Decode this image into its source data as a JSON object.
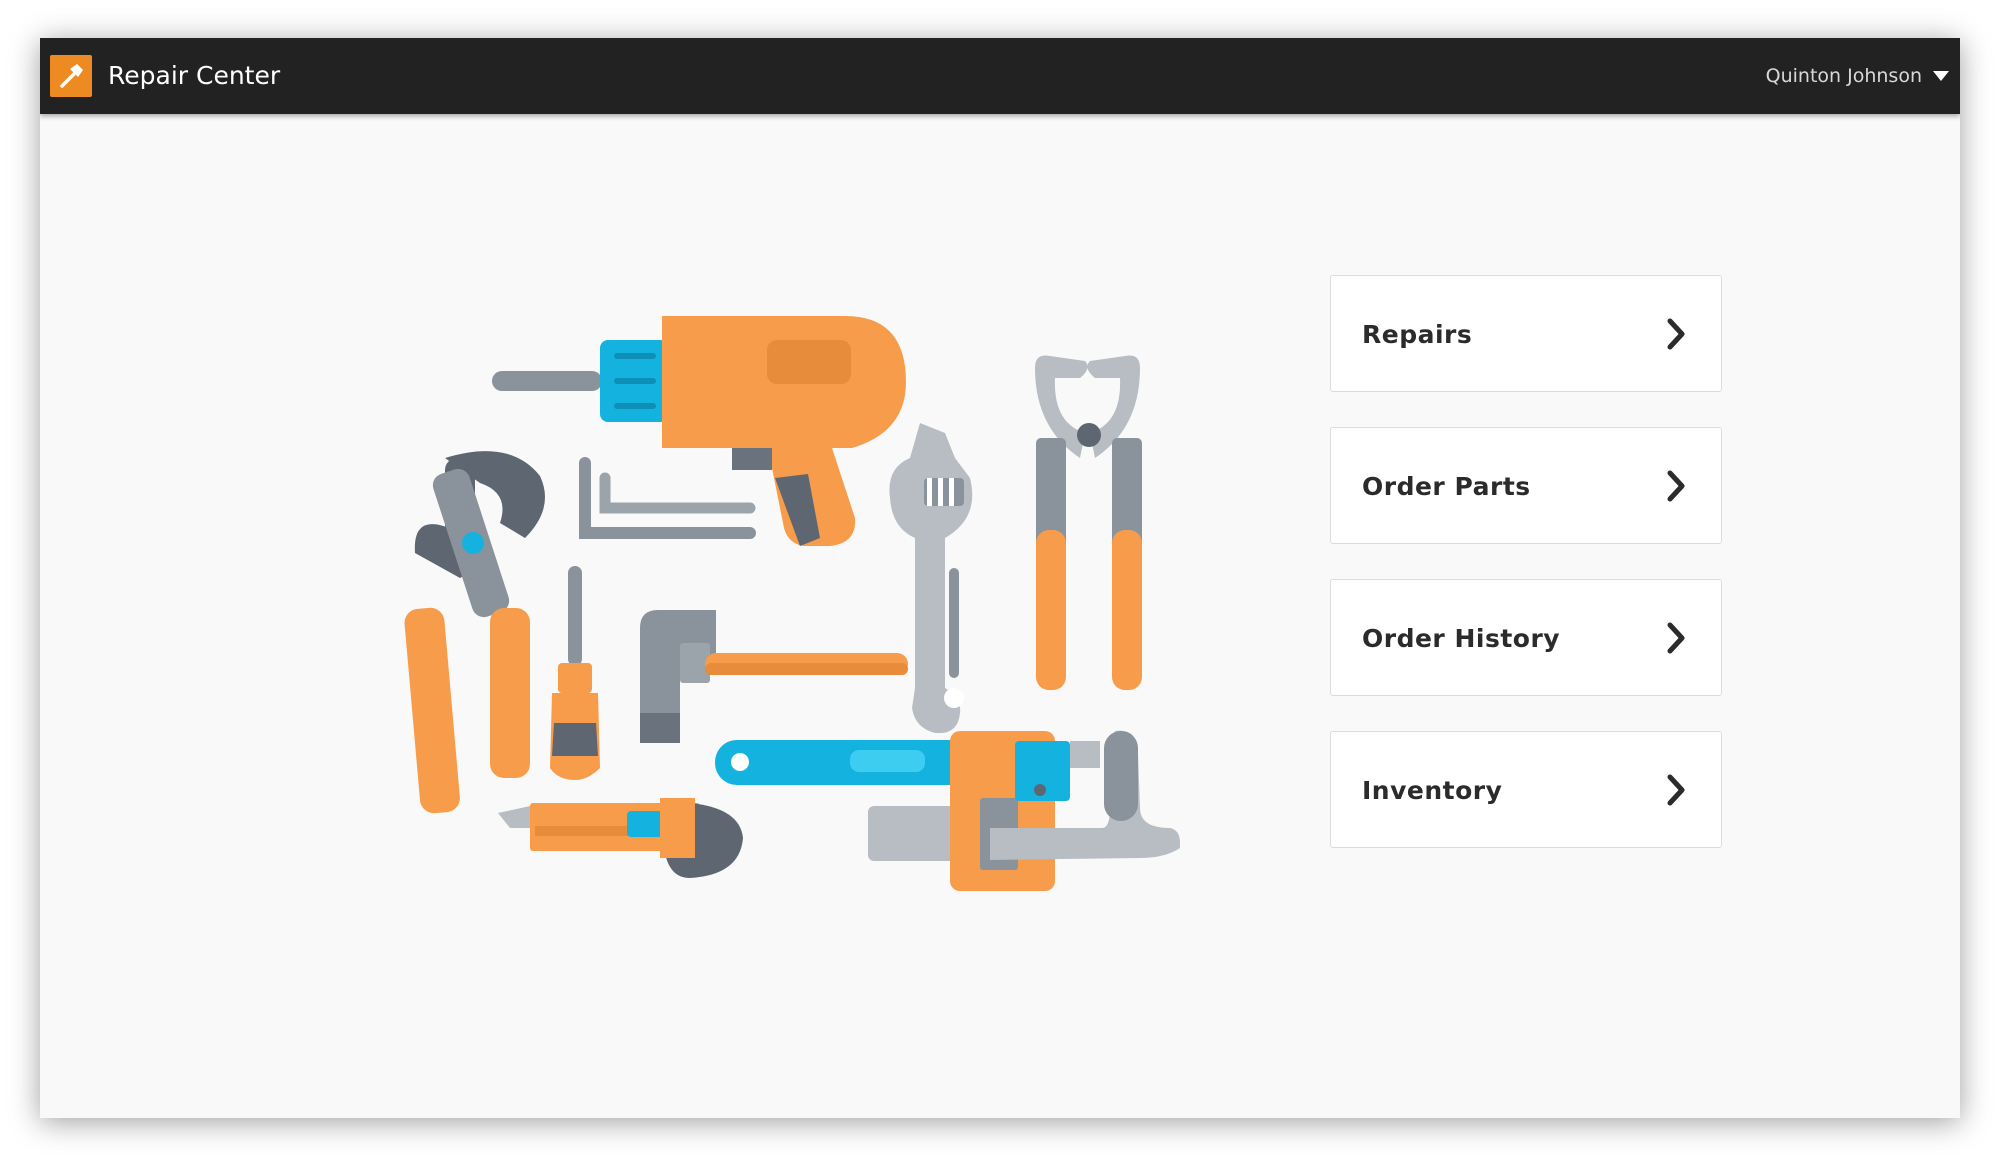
{
  "header": {
    "app_title": "Repair Center",
    "logo_icon": "hammer-icon",
    "user_name": "Quinton Johnson",
    "user_menu_icon": "caret-down-icon"
  },
  "illustration": {
    "icon": "tools-illustration",
    "colors": {
      "orange": "#f79c4b",
      "blue": "#14b3df",
      "gray": "#8a929b",
      "dark_gray": "#5d6671",
      "light_gray": "#b8bcc3"
    }
  },
  "menu": {
    "items": [
      {
        "label": "Repairs",
        "icon": "chevron-right-icon"
      },
      {
        "label": "Order Parts",
        "icon": "chevron-right-icon"
      },
      {
        "label": "Order History",
        "icon": "chevron-right-icon"
      },
      {
        "label": "Inventory",
        "icon": "chevron-right-icon"
      }
    ]
  },
  "colors": {
    "accent": "#ee8a22",
    "topbar": "#222222",
    "background": "#f9f9f9"
  }
}
